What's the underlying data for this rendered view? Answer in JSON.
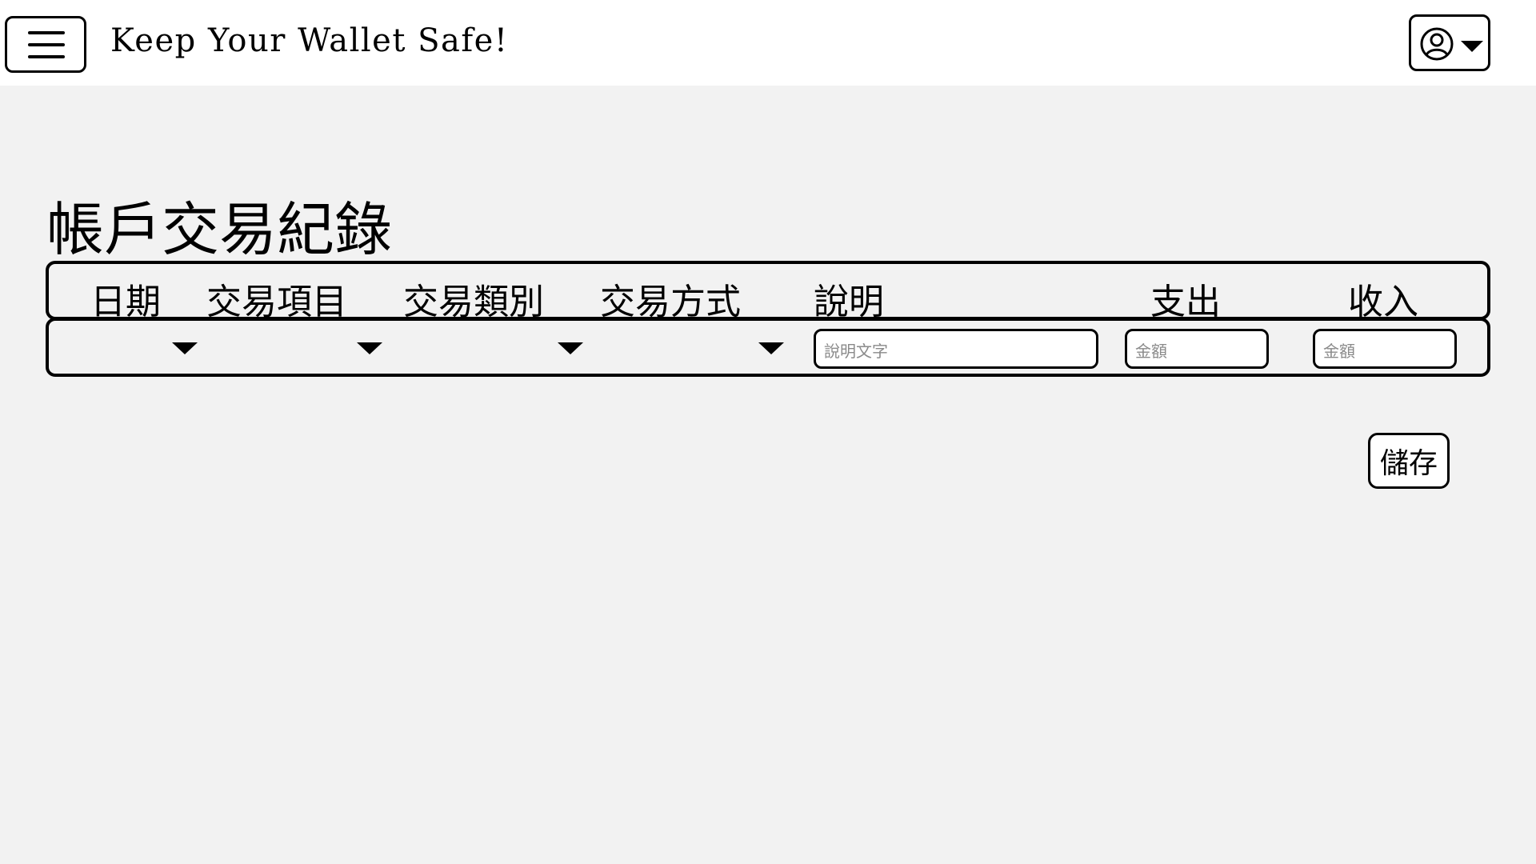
{
  "header": {
    "app_title": "Keep Your Wallet Safe!",
    "menu_icon": "hamburger-menu-icon",
    "user_icon": "user-circle-icon",
    "user_dropdown_icon": "caret-down-icon"
  },
  "page": {
    "title": "帳戶交易紀錄"
  },
  "table": {
    "columns": [
      "日期",
      "交易項目",
      "交易類別",
      "交易方式",
      "說明",
      "支出",
      "收入"
    ],
    "row": {
      "description_placeholder": "說明文字",
      "expense_placeholder": "金額",
      "income_placeholder": "金額"
    }
  },
  "actions": {
    "save_label": "儲存"
  },
  "colors": {
    "background": "#f2f2f2",
    "header_bg": "#ffffff",
    "border": "#000000"
  }
}
